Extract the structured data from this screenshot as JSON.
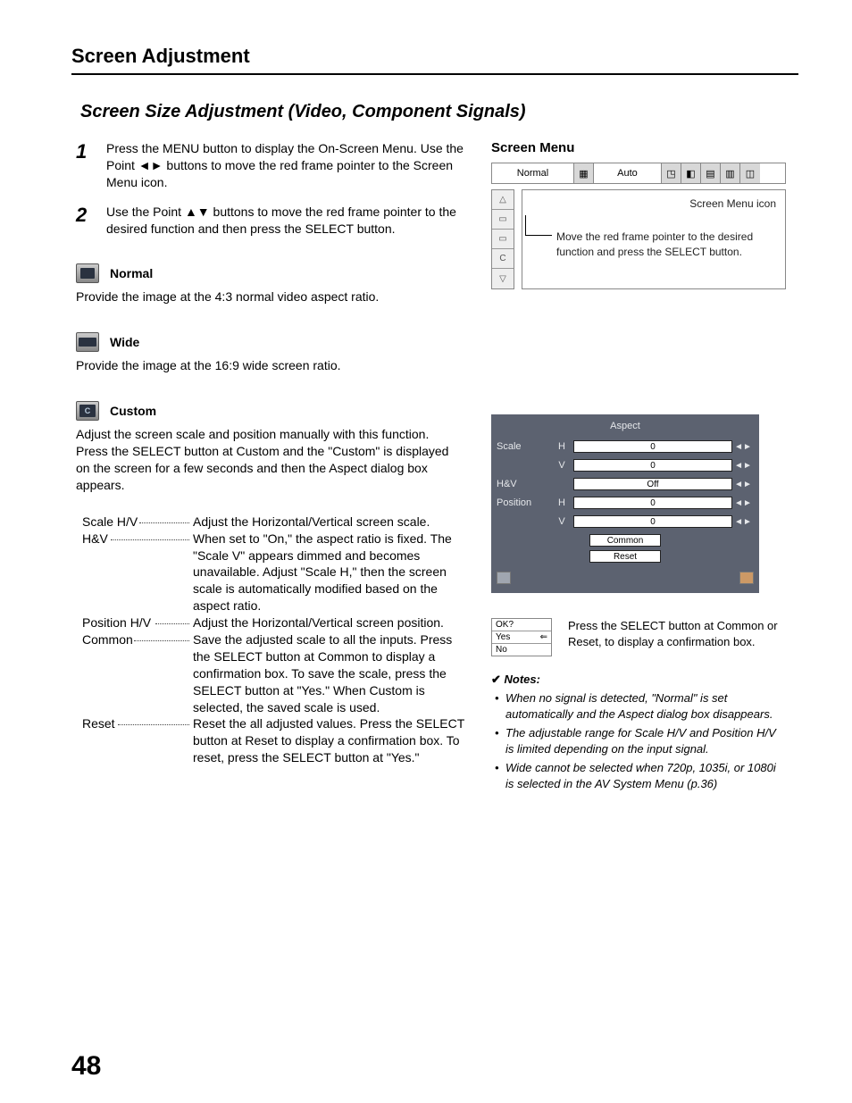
{
  "header": "Screen Adjustment",
  "section_title": "Screen Size Adjustment (Video, Component Signals)",
  "steps": [
    {
      "num": "1",
      "text": "Press the MENU button to display the On-Screen Menu. Use the Point ◄► buttons to move the red frame pointer to the Screen Menu icon."
    },
    {
      "num": "2",
      "text": "Use the Point ▲▼ buttons to move the red frame pointer to the desired function and then press the SELECT button."
    }
  ],
  "modes": {
    "normal": {
      "title": "Normal",
      "desc": "Provide the image at the 4:3 normal video aspect ratio."
    },
    "wide": {
      "title": "Wide",
      "desc": "Provide the image at the 16:9 wide screen ratio."
    },
    "custom": {
      "title": "Custom",
      "desc": "Adjust the screen scale and position manually with this function.\nPress the SELECT button at Custom and the \"Custom\" is displayed on the screen for a few seconds and then the Aspect dialog box appears."
    }
  },
  "params": [
    {
      "label": "Scale H/V",
      "desc": "Adjust the Horizontal/Vertical screen scale."
    },
    {
      "label": "H&V",
      "desc": "When set to \"On,\" the aspect ratio is fixed. The \"Scale V\" appears dimmed and becomes unavailable. Adjust \"Scale H,\" then the screen scale is automatically modified based on the aspect ratio."
    },
    {
      "label": "Position H/V",
      "desc": "Adjust the Horizontal/Vertical screen position."
    },
    {
      "label": "Common",
      "desc": "Save the adjusted scale to all the inputs. Press the SELECT button at Common to display a confirmation box. To save the scale, press the SELECT button at \"Yes.\" When Custom is selected, the saved scale is used."
    },
    {
      "label": "Reset",
      "desc": "Reset the all adjusted values. Press the SELECT button at Reset to display a confirmation box. To reset, press the SELECT button at \"Yes.\""
    }
  ],
  "screen_menu": {
    "heading": "Screen Menu",
    "top_left": "Normal",
    "top_right": "Auto",
    "label_icon": "Screen Menu icon",
    "label_move": "Move the red frame pointer to the desired function and press the SELECT button."
  },
  "aspect_panel": {
    "title": "Aspect",
    "rows": [
      {
        "l": "Scale",
        "r": "H",
        "v": "0"
      },
      {
        "l": "",
        "r": "V",
        "v": "0"
      },
      {
        "l": "H&V",
        "r": "",
        "v": "Off"
      },
      {
        "l": "Position",
        "r": "H",
        "v": "0"
      },
      {
        "l": "",
        "r": "V",
        "v": "0"
      }
    ],
    "btn_common": "Common",
    "btn_reset": "Reset"
  },
  "confirm": {
    "ok": "OK?",
    "yes": "Yes",
    "no": "No",
    "text": "Press the SELECT button at Common or Reset, to display a confirmation box."
  },
  "notes_head": "Notes:",
  "notes": [
    "When no signal is detected, \"Normal\" is set automatically and the Aspect dialog box disappears.",
    "The adjustable range for Scale H/V and Position H/V is limited depending on the input signal.",
    "Wide cannot be selected when 720p, 1035i, or 1080i is selected in the AV System Menu (p.36)"
  ],
  "page_number": "48"
}
